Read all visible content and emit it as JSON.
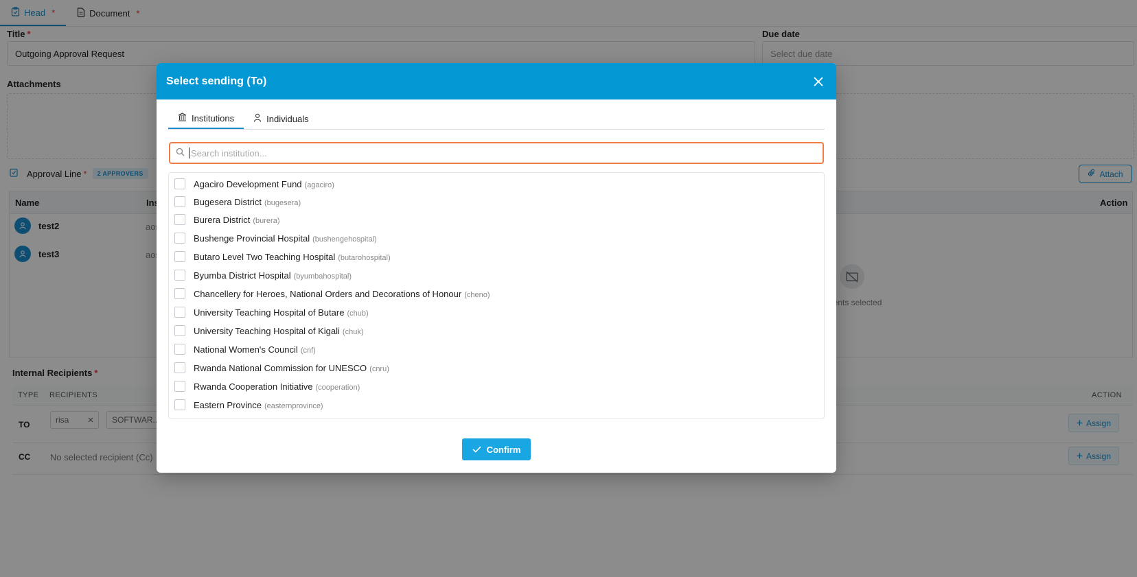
{
  "background": {
    "tabs": [
      {
        "label": "Head",
        "required": "*"
      },
      {
        "label": "Document",
        "required": "*"
      }
    ],
    "title_label": "Title",
    "title_required": "*",
    "title_value": "Outgoing Approval Request",
    "due_date_label": "Due date",
    "due_date_placeholder": "Select due date",
    "attachments_label": "Attachments",
    "approval_line_label": "Approval Line",
    "approval_line_required": "*",
    "approvers_badge": "2 APPROVERS",
    "attach_button": "Attach",
    "table_headers": {
      "name": "Name",
      "institution": "Ins",
      "action": "Action"
    },
    "approvers": [
      {
        "name": "test2",
        "inst": "aos"
      },
      {
        "name": "test3",
        "inst": "aos"
      }
    ],
    "empty_documents_text": "uments selected",
    "internal_recipients_label": "Internal Recipients",
    "internal_recipients_required": "*",
    "recipients_headers": {
      "type": "TYPE",
      "recipients": "RECIPIENTS",
      "action": "ACTION"
    },
    "rows": [
      {
        "type": "TO",
        "chips": [
          "risa",
          "SOFTWAR..."
        ],
        "assign": "Assign"
      },
      {
        "type": "CC",
        "empty": "No selected recipient (Cc)",
        "assign": "Assign"
      }
    ]
  },
  "modal": {
    "title": "Select sending (To)",
    "tabs": [
      {
        "label": "Institutions",
        "icon": "institution-icon"
      },
      {
        "label": "Individuals",
        "icon": "person-icon"
      }
    ],
    "search_placeholder": "Search institution...",
    "institutions": [
      {
        "name": "Agaciro Development Fund",
        "code": "(agaciro)"
      },
      {
        "name": "Bugesera District",
        "code": "(bugesera)"
      },
      {
        "name": "Burera District",
        "code": "(burera)"
      },
      {
        "name": "Bushenge Provincial Hospital",
        "code": "(bushengehospital)"
      },
      {
        "name": "Butaro Level Two Teaching Hospital",
        "code": "(butarohospital)"
      },
      {
        "name": "Byumba District Hospital",
        "code": "(byumbahospital)"
      },
      {
        "name": "Chancellery for Heroes, National Orders and Decorations of Honour",
        "code": "(cheno)"
      },
      {
        "name": "University Teaching Hospital of Butare",
        "code": "(chub)"
      },
      {
        "name": "University Teaching Hospital of Kigali",
        "code": "(chuk)"
      },
      {
        "name": "National Women's Council",
        "code": "(cnf)"
      },
      {
        "name": "Rwanda National Commission for UNESCO",
        "code": "(cnru)"
      },
      {
        "name": "Rwanda Cooperation Initiative",
        "code": "(cooperation)"
      },
      {
        "name": "Eastern Province",
        "code": "(easternprovince)"
      }
    ],
    "confirm_label": "Confirm"
  },
  "colors": {
    "header": "#0398d4",
    "accent": "#1a8fd0",
    "search_focus": "#f07c48",
    "confirm": "#1aa6e2"
  }
}
